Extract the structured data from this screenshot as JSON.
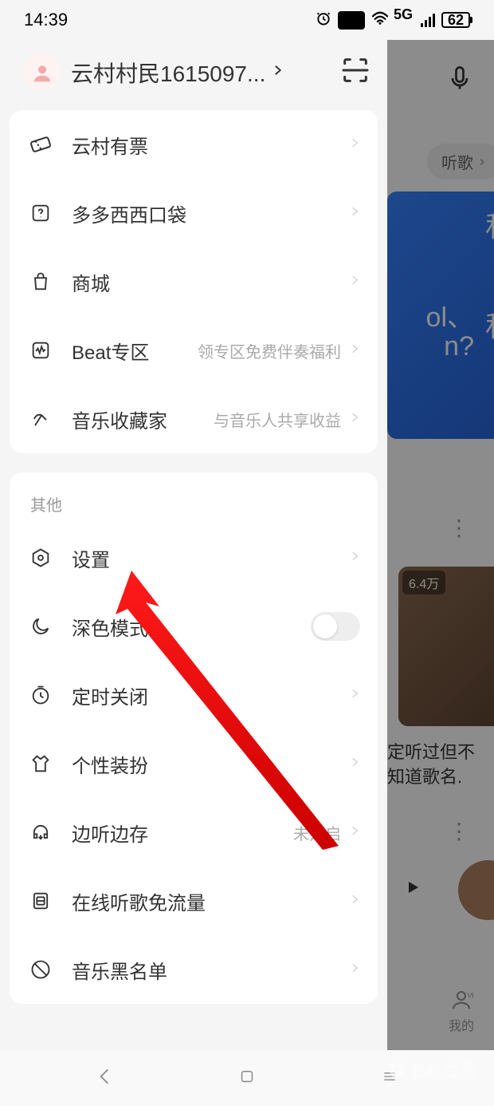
{
  "status": {
    "time": "14:39",
    "battery": "62",
    "network": "5G"
  },
  "header": {
    "username": "云村村民1615097..."
  },
  "card1_items": [
    {
      "icon": "ticket",
      "label": "云村有票",
      "sub": ""
    },
    {
      "icon": "question-box",
      "label": "多多西西口袋",
      "sub": ""
    },
    {
      "icon": "shop",
      "label": "商城",
      "sub": ""
    },
    {
      "icon": "wave-box",
      "label": "Beat专区",
      "sub": "领专区免费伴奏福利"
    },
    {
      "icon": "hammer",
      "label": "音乐收藏家",
      "sub": "与音乐人共享收益"
    }
  ],
  "section_other": "其他",
  "card2_items": [
    {
      "icon": "hexagon",
      "label": "设置",
      "sub": "",
      "type": "chevron"
    },
    {
      "icon": "moon",
      "label": "深色模式",
      "sub": "",
      "type": "toggle"
    },
    {
      "icon": "timer",
      "label": "定时关闭",
      "sub": "",
      "type": "chevron"
    },
    {
      "icon": "shirt",
      "label": "个性装扮",
      "sub": "",
      "type": "chevron"
    },
    {
      "icon": "headphone-down",
      "label": "边听边存",
      "sub": "未开启",
      "type": "chevron"
    },
    {
      "icon": "sim",
      "label": "在线听歌免流量",
      "sub": "",
      "type": "chevron"
    },
    {
      "icon": "ban",
      "label": "音乐黑名单",
      "sub": "",
      "type": "chevron"
    }
  ],
  "bg": {
    "pill": "听歌",
    "card_text_line1": "定听过但不",
    "card_text_line2": "知道歌名.",
    "badge_64": "6.4万",
    "vip_label": "我的"
  },
  "watermark": "Bai 经验"
}
